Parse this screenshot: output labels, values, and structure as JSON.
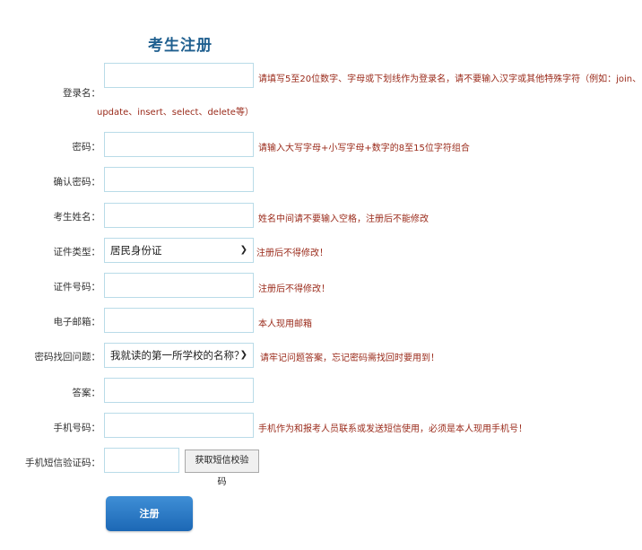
{
  "page": {
    "title": "考生注册"
  },
  "form": {
    "username": {
      "label": "登录名：",
      "value": "",
      "hint_line1": "请填写5至20位数字、字母或下划线作为登录名，请不要输入汉字或其他特殊字符（例如：join、",
      "hint_line2": "update、insert、select、delete等）"
    },
    "password": {
      "label": "密码：",
      "value": "",
      "hint": "请输入大写字母+小写字母+数字的8至15位字符组合"
    },
    "confirm_password": {
      "label": "确认密码：",
      "value": ""
    },
    "name": {
      "label": "考生姓名：",
      "value": "",
      "hint": "姓名中间请不要输入空格，注册后不能修改"
    },
    "id_type": {
      "label": "证件类型：",
      "selected": "居民身份证",
      "hint": "注册后不得修改！"
    },
    "id_number": {
      "label": "证件号码：",
      "value": "",
      "hint": "注册后不得修改！"
    },
    "email": {
      "label": "电子邮箱：",
      "value": "",
      "hint": "本人现用邮箱"
    },
    "security_question": {
      "label": "密码找回问题：",
      "selected": "我就读的第一所学校的名称？",
      "hint": "请牢记问题答案，忘记密码需找回时要用到！"
    },
    "answer": {
      "label": "答案：",
      "value": ""
    },
    "phone": {
      "label": "手机号码：",
      "value": "",
      "hint": "手机作为和报考人员联系或发送短信使用，必须是本人现用手机号！"
    },
    "sms_code": {
      "label": "手机短信验证码：",
      "value": "",
      "button": "获取短信校验码"
    },
    "submit": "注册"
  },
  "icons": {
    "dropdown": "chevron-down-icon"
  }
}
